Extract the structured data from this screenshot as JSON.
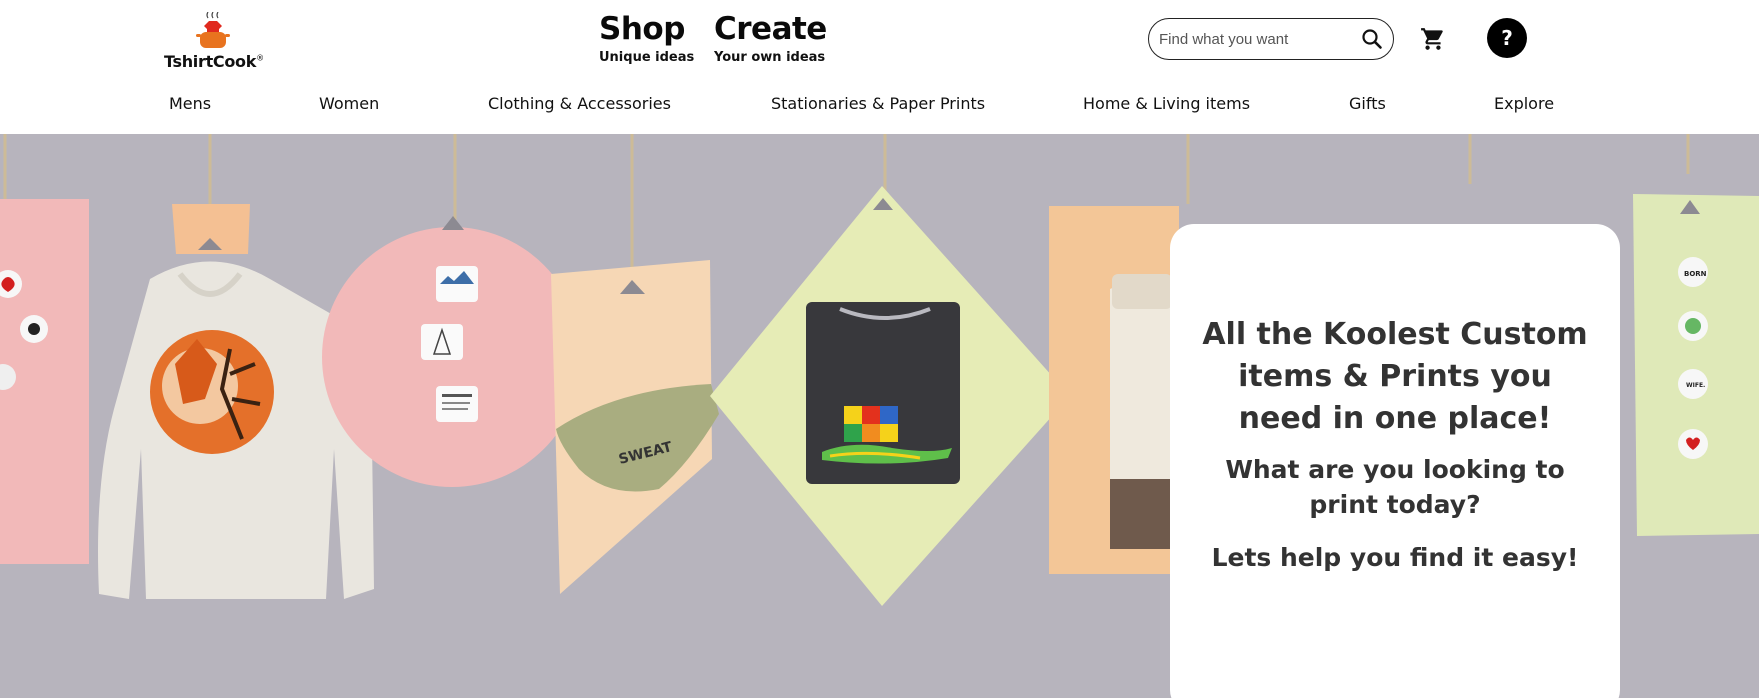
{
  "brand": {
    "name": "TshirtCook",
    "trademark": "®"
  },
  "modes": {
    "shop": {
      "title": "Shop",
      "subtitle": "Unique ideas"
    },
    "create": {
      "title": "Create",
      "subtitle": "Your own ideas"
    }
  },
  "search": {
    "placeholder": "Find what you want",
    "value": ""
  },
  "help": {
    "label": "?"
  },
  "nav": {
    "items": [
      "Mens",
      "Women",
      "Clothing & Accessories",
      "Stationaries & Paper Prints",
      "Home & Living items",
      "Gifts",
      "Explore"
    ]
  },
  "hero": {
    "headline": "All the Koolest Custom items & Prints you need in one place!",
    "question": "What are you looking to print today?",
    "tagline": "Lets help you find it easy!",
    "bag_print": "SWEAT IS JUST FAT CRYING"
  },
  "colors": {
    "hero_background": "#b7b4bd",
    "card_background": "#ffffff",
    "text_dark": "#333333",
    "accent_orange": "#e8731f"
  },
  "icons": [
    "search-icon",
    "cart-icon",
    "help-icon",
    "logo-pot-icon"
  ]
}
